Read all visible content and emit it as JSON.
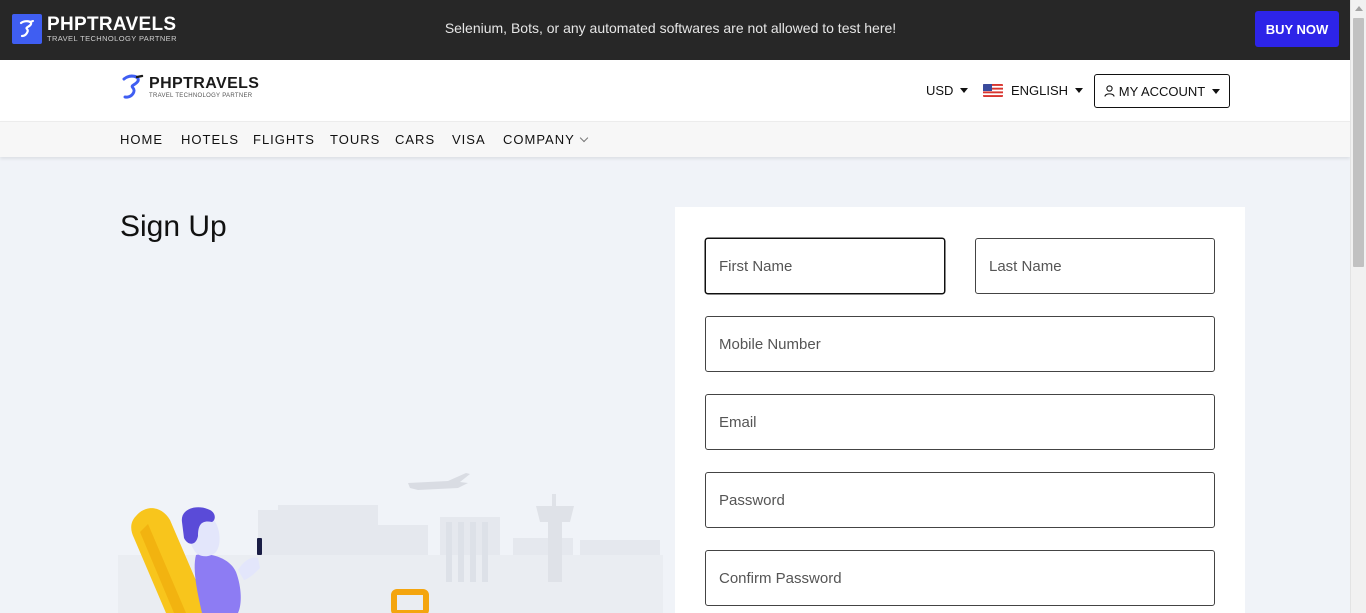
{
  "topbar": {
    "logo_name": "PHPTRAVELS",
    "logo_tagline": "TRAVEL TECHNOLOGY PARTNER",
    "notice": "Selenium, Bots, or any automated softwares are not allowed to test here!",
    "buy_now": "BUY NOW"
  },
  "header": {
    "logo_name": "PHPTRAVELS",
    "logo_tagline": "TRAVEL TECHNOLOGY PARTNER",
    "currency": "USD",
    "language": "ENGLISH",
    "account": "MY ACCOUNT"
  },
  "nav": {
    "items": [
      "HOME",
      "HOTELS",
      "FLIGHTS",
      "TOURS",
      "CARS",
      "VISA",
      "COMPANY"
    ]
  },
  "page": {
    "title": "Sign Up"
  },
  "form": {
    "first_name_placeholder": "First Name",
    "last_name_placeholder": "Last Name",
    "mobile_placeholder": "Mobile Number",
    "email_placeholder": "Email",
    "password_placeholder": "Password",
    "confirm_password_placeholder": "Confirm Password"
  },
  "colors": {
    "topbar_bg": "#272727",
    "brand_blue": "#3f5ef2",
    "buy_now_bg": "#2d24e8",
    "page_bg": "#f0f3f8"
  }
}
